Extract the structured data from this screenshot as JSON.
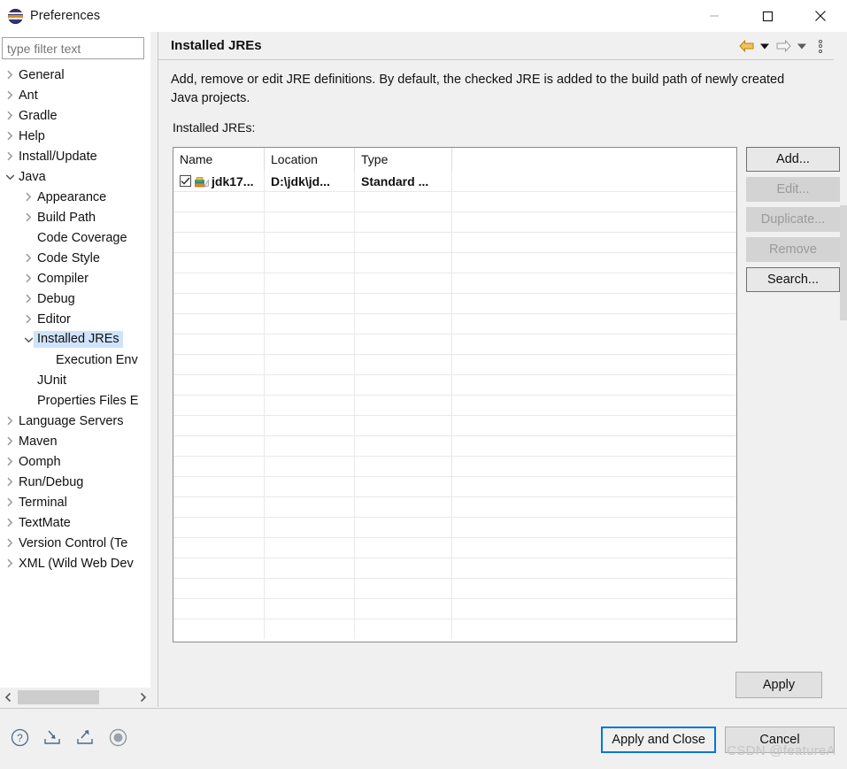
{
  "window": {
    "title": "Preferences",
    "logo_icon": "eclipse-logo",
    "controls": {
      "minimize": "minimize-icon",
      "maximize": "maximize-icon",
      "close": "close-icon"
    }
  },
  "sidebar": {
    "filter": {
      "value": "",
      "placeholder": "type filter text"
    },
    "items": [
      {
        "label": "General",
        "indent": 0,
        "twisty": "collapsed",
        "selected": false
      },
      {
        "label": "Ant",
        "indent": 0,
        "twisty": "collapsed",
        "selected": false
      },
      {
        "label": "Gradle",
        "indent": 0,
        "twisty": "collapsed",
        "selected": false
      },
      {
        "label": "Help",
        "indent": 0,
        "twisty": "collapsed",
        "selected": false
      },
      {
        "label": "Install/Update",
        "indent": 0,
        "twisty": "collapsed",
        "selected": false
      },
      {
        "label": "Java",
        "indent": 0,
        "twisty": "expanded",
        "selected": false
      },
      {
        "label": "Appearance",
        "indent": 1,
        "twisty": "collapsed",
        "selected": false
      },
      {
        "label": "Build Path",
        "indent": 1,
        "twisty": "collapsed",
        "selected": false
      },
      {
        "label": "Code Coverage",
        "indent": 1,
        "twisty": "none",
        "selected": false
      },
      {
        "label": "Code Style",
        "indent": 1,
        "twisty": "collapsed",
        "selected": false
      },
      {
        "label": "Compiler",
        "indent": 1,
        "twisty": "collapsed",
        "selected": false
      },
      {
        "label": "Debug",
        "indent": 1,
        "twisty": "collapsed",
        "selected": false
      },
      {
        "label": "Editor",
        "indent": 1,
        "twisty": "collapsed",
        "selected": false
      },
      {
        "label": "Installed JREs",
        "indent": 1,
        "twisty": "expanded",
        "selected": true
      },
      {
        "label": "Execution Env",
        "indent": 2,
        "twisty": "none",
        "selected": false
      },
      {
        "label": "JUnit",
        "indent": 1,
        "twisty": "none",
        "selected": false
      },
      {
        "label": "Properties Files E",
        "indent": 1,
        "twisty": "none",
        "selected": false
      },
      {
        "label": "Language Servers",
        "indent": 0,
        "twisty": "collapsed",
        "selected": false
      },
      {
        "label": "Maven",
        "indent": 0,
        "twisty": "collapsed",
        "selected": false
      },
      {
        "label": "Oomph",
        "indent": 0,
        "twisty": "collapsed",
        "selected": false
      },
      {
        "label": "Run/Debug",
        "indent": 0,
        "twisty": "collapsed",
        "selected": false
      },
      {
        "label": "Terminal",
        "indent": 0,
        "twisty": "collapsed",
        "selected": false
      },
      {
        "label": "TextMate",
        "indent": 0,
        "twisty": "collapsed",
        "selected": false
      },
      {
        "label": "Version Control (Te",
        "indent": 0,
        "twisty": "collapsed",
        "selected": false
      },
      {
        "label": "XML (Wild Web Dev",
        "indent": 0,
        "twisty": "collapsed",
        "selected": false
      }
    ],
    "hscroll": {
      "left_arrow_icon": "chevron-left-icon",
      "right_arrow_icon": "chevron-right-icon"
    }
  },
  "page": {
    "title": "Installed JREs",
    "nav": {
      "back_icon": "back-arrow-icon",
      "back_menu_icon": "chevron-down-icon",
      "forward_icon": "forward-arrow-icon",
      "forward_menu_icon": "chevron-down-icon",
      "view_menu_icon": "vertical-dots-icon"
    },
    "description": "Add, remove or edit JRE definitions. By default, the checked JRE is added to the build path of newly created Java projects.",
    "table_label": "Installed JREs:"
  },
  "table": {
    "columns": [
      "Name",
      "Location",
      "Type",
      ""
    ],
    "rows": [
      {
        "checked": true,
        "icon": "jre-library-icon",
        "name": "jdk17...",
        "location": "D:\\jdk\\jd...",
        "type": "Standard ...",
        "extra": ""
      }
    ],
    "empty_row_count": 22
  },
  "side_buttons": [
    {
      "label": "Add...",
      "enabled": true
    },
    {
      "label": "Edit...",
      "enabled": false
    },
    {
      "label": "Duplicate...",
      "enabled": false
    },
    {
      "label": "Remove",
      "enabled": false
    },
    {
      "label": "Search...",
      "enabled": true
    }
  ],
  "apply_button": {
    "label": "Apply"
  },
  "footer": {
    "icons": [
      {
        "name": "help-icon"
      },
      {
        "name": "import-icon"
      },
      {
        "name": "export-icon"
      },
      {
        "name": "restore-defaults-icon"
      }
    ],
    "buttons": [
      {
        "label": "Apply and Close",
        "focused": true
      },
      {
        "label": "Cancel",
        "focused": false
      }
    ]
  },
  "watermark": "CSDN @featureA",
  "colors": {
    "selection": "#cfe4fb",
    "focus_border": "#0078d7",
    "panel_bg": "#f0f0f0",
    "field_bg": "#ffffff",
    "disabled_text": "#9a9a9a"
  }
}
